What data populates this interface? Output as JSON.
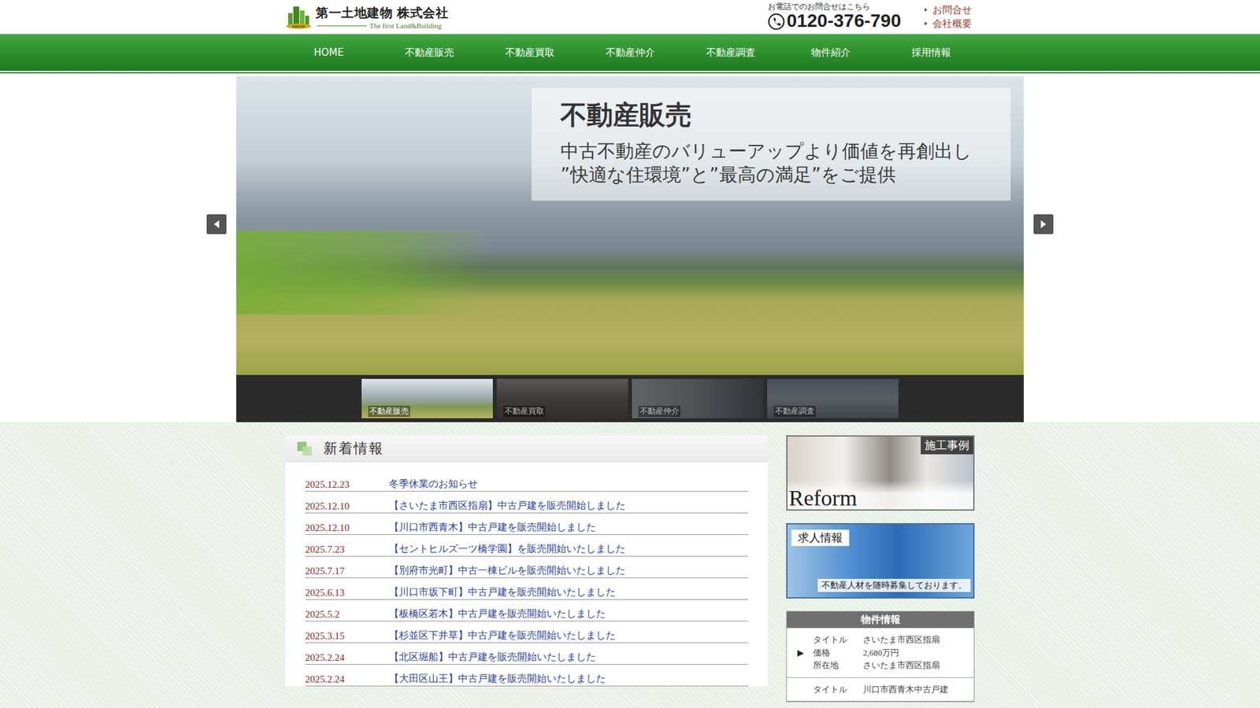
{
  "header": {
    "logo_mark": "DAIICHI",
    "company": "第一土地建物 株式会社",
    "tagline": "The first Land&Building",
    "phone_caption": "お電話でのお問合せはこちら",
    "phone": "0120-376-790",
    "links": [
      "お問合せ",
      "会社概要"
    ]
  },
  "nav": [
    "HOME",
    "不動産販売",
    "不動産買取",
    "不動産仲介",
    "不動産調査",
    "物件紹介",
    "採用情報"
  ],
  "slider": {
    "caption_title": "不動産販売",
    "caption_lines": [
      "中古不動産のバリューアップより価値を再創出し",
      "”快適な住環境”と”最高の満足”をご提供"
    ],
    "thumbs": [
      {
        "label": "不動産販売",
        "selected": true
      },
      {
        "label": "不動産買取",
        "selected": false
      },
      {
        "label": "不動産仲介",
        "selected": false
      },
      {
        "label": "不動産調査",
        "selected": false
      }
    ]
  },
  "news": {
    "title": "新着情報",
    "items": [
      {
        "date": "2025.12.23",
        "title": "冬季休業のお知らせ"
      },
      {
        "date": "2025.12.10",
        "title": "【さいたま市西区指扇】中古戸建を販売開始しました"
      },
      {
        "date": "2025.12.10",
        "title": "【川口市西青木】中古戸建を販売開始しました"
      },
      {
        "date": "2025.7.23",
        "title": "【セントヒルズ一ツ橋学園】を販売開始いたしました"
      },
      {
        "date": "2025.7.17",
        "title": "【別府市光町】中古一棟ビルを販売開始いたしました"
      },
      {
        "date": "2025.6.13",
        "title": "【川口市坂下町】中古戸建を販売開始いたしました"
      },
      {
        "date": "2025.5.2",
        "title": "【板橋区若木】中古戸建を販売開始いたしました"
      },
      {
        "date": "2025.3.15",
        "title": "【杉並区下井草】中古戸建を販売開始いたしました"
      },
      {
        "date": "2025.2.24",
        "title": "【北区堀船】中古戸建を販売開始いたしました"
      },
      {
        "date": "2025.2.24",
        "title": "【大田区山王】中古戸建を販売開始いたしました"
      }
    ]
  },
  "sidebar": {
    "reform": {
      "label": "施工事例",
      "word": "Reform"
    },
    "recruit": {
      "label": "求人情報",
      "text": "不動産人材を随時募集しております。"
    },
    "properties": {
      "title": "物件情報",
      "items": [
        {
          "marker": "▶",
          "fields": [
            {
              "label": "タイトル",
              "value": "さいたま市西区指扇"
            },
            {
              "label": "価格",
              "value": "2,680万円"
            },
            {
              "label": "所在地",
              "value": "さいたま市西区指扇"
            }
          ]
        },
        {
          "fields": [
            {
              "label": "タイトル",
              "value": "川口市西青木中古戸建"
            }
          ]
        }
      ]
    }
  }
}
